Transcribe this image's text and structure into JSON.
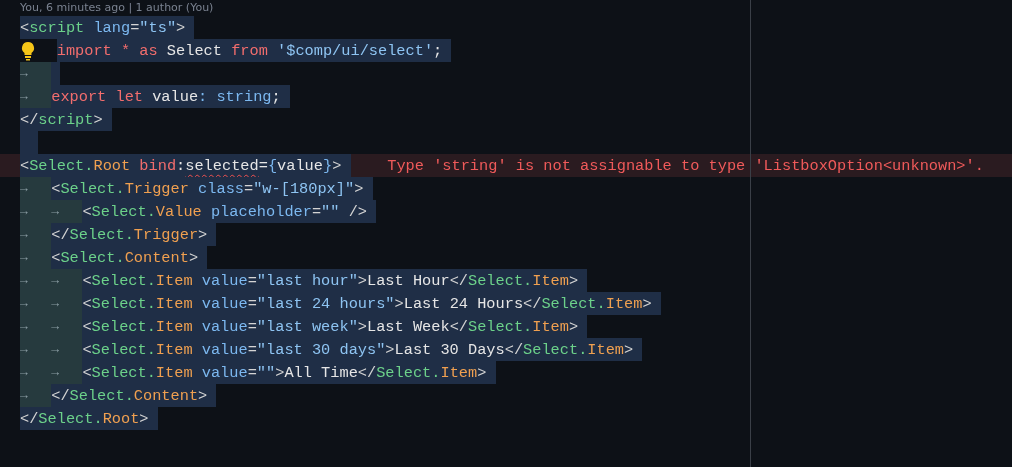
{
  "codelens": "You, 6 minutes ago | 1 author (You)",
  "lines": [
    {
      "selected": true,
      "tokens": [
        {
          "kind": "p",
          "text": "<"
        },
        {
          "kind": "tg",
          "text": "script"
        },
        {
          "kind": "at",
          "text": " lang"
        },
        {
          "kind": "p",
          "text": "="
        },
        {
          "kind": "st",
          "text": "\"ts\""
        },
        {
          "kind": "p",
          "text": ">"
        }
      ]
    },
    {
      "selected": true,
      "tokens": [
        {
          "kind": "bulb"
        },
        {
          "kind": "kw",
          "text": "import * as"
        },
        {
          "kind": "tx",
          "text": " Select "
        },
        {
          "kind": "kw",
          "text": "from"
        },
        {
          "kind": "st",
          "text": " '$comp/ui/select'"
        },
        {
          "kind": "tx",
          "text": ";"
        }
      ]
    },
    {
      "selected": true,
      "tokens": [
        {
          "kind": "tab",
          "text": "→"
        }
      ]
    },
    {
      "selected": true,
      "tokens": [
        {
          "kind": "tab",
          "text": "→"
        },
        {
          "kind": "kw",
          "text": "export let"
        },
        {
          "kind": "tx",
          "text": " value"
        },
        {
          "kind": "ty",
          "text": ": string"
        },
        {
          "kind": "tx",
          "text": ";"
        }
      ]
    },
    {
      "selected": true,
      "tokens": [
        {
          "kind": "p",
          "text": "</"
        },
        {
          "kind": "tg",
          "text": "script"
        },
        {
          "kind": "p",
          "text": ">"
        }
      ]
    },
    {
      "selected": true
    },
    {
      "selected": true,
      "error": "Type 'string' is not assignable to type 'ListboxOption<unknown>'.",
      "tokens": [
        {
          "kind": "p",
          "text": "<"
        },
        {
          "kind": "tg",
          "text": "Select."
        },
        {
          "kind": "cp",
          "text": "Root"
        },
        {
          "kind": "kw",
          "text": " bind"
        },
        {
          "kind": "tx",
          "text": ":"
        },
        {
          "kind": "sq",
          "text": "selected"
        },
        {
          "kind": "tx",
          "text": "="
        },
        {
          "kind": "ty",
          "text": "{"
        },
        {
          "kind": "tx",
          "text": "value"
        },
        {
          "kind": "ty",
          "text": "}"
        },
        {
          "kind": "p",
          "text": ">"
        }
      ]
    },
    {
      "selected": true,
      "tokens": [
        {
          "kind": "tab",
          "text": "→"
        },
        {
          "kind": "p",
          "text": "<"
        },
        {
          "kind": "tg",
          "text": "Select."
        },
        {
          "kind": "cp",
          "text": "Trigger"
        },
        {
          "kind": "at",
          "text": " class"
        },
        {
          "kind": "p",
          "text": "="
        },
        {
          "kind": "st",
          "text": "\"w-[180px]\""
        },
        {
          "kind": "p",
          "text": ">"
        }
      ]
    },
    {
      "selected": true,
      "tokens": [
        {
          "kind": "tab",
          "text": "→"
        },
        {
          "kind": "tab",
          "text": "→"
        },
        {
          "kind": "p",
          "text": "<"
        },
        {
          "kind": "tg",
          "text": "Select."
        },
        {
          "kind": "cp",
          "text": "Value"
        },
        {
          "kind": "at",
          "text": " placeholder"
        },
        {
          "kind": "p",
          "text": "="
        },
        {
          "kind": "st",
          "text": "\"\""
        },
        {
          "kind": "p",
          "text": " />"
        }
      ]
    },
    {
      "selected": true,
      "tokens": [
        {
          "kind": "tab",
          "text": "→"
        },
        {
          "kind": "p",
          "text": "</"
        },
        {
          "kind": "tg",
          "text": "Select."
        },
        {
          "kind": "cp",
          "text": "Trigger"
        },
        {
          "kind": "p",
          "text": ">"
        }
      ]
    },
    {
      "selected": true,
      "tokens": [
        {
          "kind": "tab",
          "text": "→"
        },
        {
          "kind": "p",
          "text": "<"
        },
        {
          "kind": "tg",
          "text": "Select."
        },
        {
          "kind": "cp",
          "text": "Content"
        },
        {
          "kind": "p",
          "text": ">"
        }
      ]
    },
    {
      "selected": true,
      "tokens": [
        {
          "kind": "tab",
          "text": "→"
        },
        {
          "kind": "tab",
          "text": "→"
        },
        {
          "kind": "p",
          "text": "<"
        },
        {
          "kind": "tg",
          "text": "Select."
        },
        {
          "kind": "cp",
          "text": "Item"
        },
        {
          "kind": "at",
          "text": " value"
        },
        {
          "kind": "p",
          "text": "="
        },
        {
          "kind": "st",
          "text": "\"last hour\""
        },
        {
          "kind": "p",
          "text": ">"
        },
        {
          "kind": "tx",
          "text": "Last Hour"
        },
        {
          "kind": "p",
          "text": "</"
        },
        {
          "kind": "tg",
          "text": "Select."
        },
        {
          "kind": "cp",
          "text": "Item"
        },
        {
          "kind": "p",
          "text": ">"
        }
      ]
    },
    {
      "selected": true,
      "tokens": [
        {
          "kind": "tab",
          "text": "→"
        },
        {
          "kind": "tab",
          "text": "→"
        },
        {
          "kind": "p",
          "text": "<"
        },
        {
          "kind": "tg",
          "text": "Select."
        },
        {
          "kind": "cp",
          "text": "Item"
        },
        {
          "kind": "at",
          "text": " value"
        },
        {
          "kind": "p",
          "text": "="
        },
        {
          "kind": "st",
          "text": "\"last 24 hours\""
        },
        {
          "kind": "p",
          "text": ">"
        },
        {
          "kind": "tx",
          "text": "Last 24 Hours"
        },
        {
          "kind": "p",
          "text": "</"
        },
        {
          "kind": "tg",
          "text": "Select."
        },
        {
          "kind": "cp",
          "text": "Item"
        },
        {
          "kind": "p",
          "text": ">"
        }
      ]
    },
    {
      "selected": true,
      "tokens": [
        {
          "kind": "tab",
          "text": "→"
        },
        {
          "kind": "tab",
          "text": "→"
        },
        {
          "kind": "p",
          "text": "<"
        },
        {
          "kind": "tg",
          "text": "Select."
        },
        {
          "kind": "cp",
          "text": "Item"
        },
        {
          "kind": "at",
          "text": " value"
        },
        {
          "kind": "p",
          "text": "="
        },
        {
          "kind": "st",
          "text": "\"last week\""
        },
        {
          "kind": "p",
          "text": ">"
        },
        {
          "kind": "tx",
          "text": "Last Week"
        },
        {
          "kind": "p",
          "text": "</"
        },
        {
          "kind": "tg",
          "text": "Select."
        },
        {
          "kind": "cp",
          "text": "Item"
        },
        {
          "kind": "p",
          "text": ">"
        }
      ]
    },
    {
      "selected": true,
      "tokens": [
        {
          "kind": "tab",
          "text": "→"
        },
        {
          "kind": "tab",
          "text": "→"
        },
        {
          "kind": "p",
          "text": "<"
        },
        {
          "kind": "tg",
          "text": "Select."
        },
        {
          "kind": "cp",
          "text": "Item"
        },
        {
          "kind": "at",
          "text": " value"
        },
        {
          "kind": "p",
          "text": "="
        },
        {
          "kind": "st",
          "text": "\"last 30 days\""
        },
        {
          "kind": "p",
          "text": ">"
        },
        {
          "kind": "tx",
          "text": "Last 30 Days"
        },
        {
          "kind": "p",
          "text": "</"
        },
        {
          "kind": "tg",
          "text": "Select."
        },
        {
          "kind": "cp",
          "text": "Item"
        },
        {
          "kind": "p",
          "text": ">"
        }
      ]
    },
    {
      "selected": true,
      "tokens": [
        {
          "kind": "tab",
          "text": "→"
        },
        {
          "kind": "tab",
          "text": "→"
        },
        {
          "kind": "p",
          "text": "<"
        },
        {
          "kind": "tg",
          "text": "Select."
        },
        {
          "kind": "cp",
          "text": "Item"
        },
        {
          "kind": "at",
          "text": " value"
        },
        {
          "kind": "p",
          "text": "="
        },
        {
          "kind": "st",
          "text": "\"\""
        },
        {
          "kind": "p",
          "text": ">"
        },
        {
          "kind": "tx",
          "text": "All Time"
        },
        {
          "kind": "p",
          "text": "</"
        },
        {
          "kind": "tg",
          "text": "Select."
        },
        {
          "kind": "cp",
          "text": "Item"
        },
        {
          "kind": "p",
          "text": ">"
        }
      ]
    },
    {
      "selected": true,
      "tokens": [
        {
          "kind": "tab",
          "text": "→"
        },
        {
          "kind": "p",
          "text": "</"
        },
        {
          "kind": "tg",
          "text": "Select."
        },
        {
          "kind": "cp",
          "text": "Content"
        },
        {
          "kind": "p",
          "text": ">"
        }
      ]
    },
    {
      "selected": true,
      "tokens": [
        {
          "kind": "p",
          "text": "</"
        },
        {
          "kind": "tg",
          "text": "Select."
        },
        {
          "kind": "cp",
          "text": "Root"
        },
        {
          "kind": "p",
          "text": ">"
        }
      ]
    }
  ]
}
